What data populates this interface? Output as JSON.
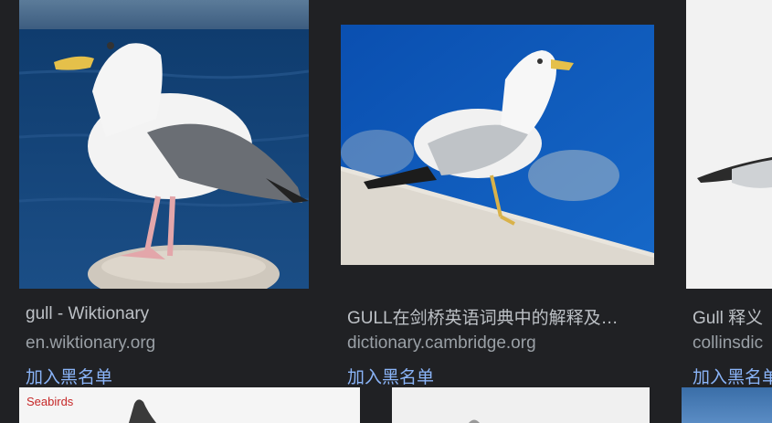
{
  "results": [
    {
      "title": "gull - Wiktionary",
      "domain": "en.wiktionary.org",
      "block_label": "加入黑名单"
    },
    {
      "title": "GULL在剑桥英语词典中的解释及…",
      "domain": "dictionary.cambridge.org",
      "block_label": "加入黑名单"
    },
    {
      "title": "Gull 释义",
      "domain": "collinsdic",
      "block_label": "加入黑名单"
    }
  ],
  "bottom_row": {
    "first_thumb_label": "Seabirds"
  },
  "colors": {
    "background": "#202124",
    "title": "#bdc1c6",
    "domain": "#9aa0a6",
    "link": "#8ab4f8"
  }
}
